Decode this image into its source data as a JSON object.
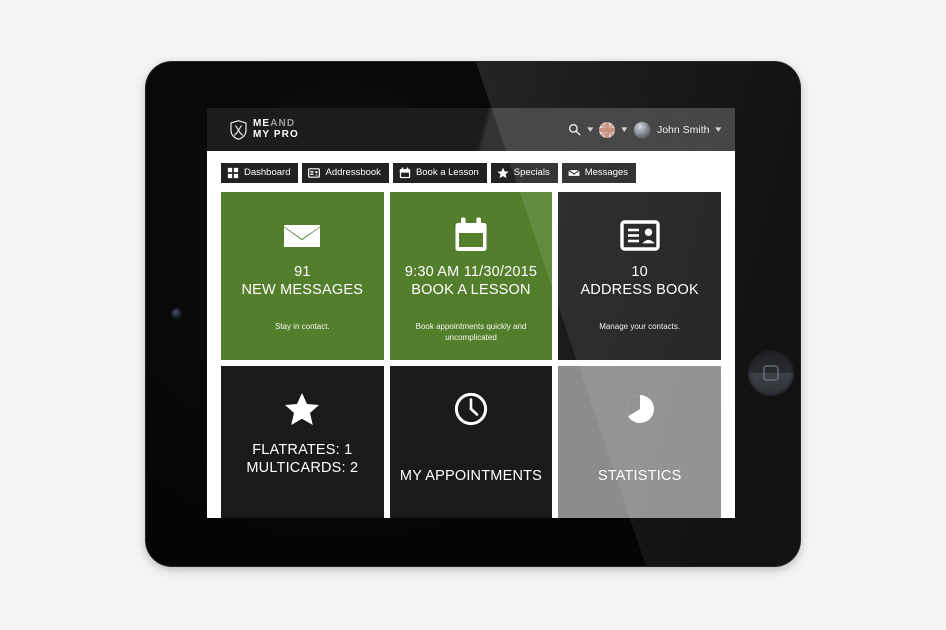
{
  "app": {
    "brand": {
      "line1_strong": "ME",
      "line1_soft": "AND",
      "line2": "MY PRO",
      "shield_icon": "shield-crossed-clubs-icon"
    },
    "header": {
      "search_icon": "search-icon",
      "search_chevron": "chevron-down-icon",
      "language_flag": "uk-flag-icon",
      "language_chevron": "chevron-down-icon",
      "avatar_icon": "user-avatar",
      "user_name": "John Smith",
      "user_chevron": "chevron-down-icon"
    },
    "nav": [
      {
        "label": "Dashboard",
        "icon": "grid-icon"
      },
      {
        "label": "Addressbook",
        "icon": "contact-card-icon"
      },
      {
        "label": "Book a Lesson",
        "icon": "calendar-icon"
      },
      {
        "label": "Specials",
        "icon": "star-icon"
      },
      {
        "label": "Messages",
        "icon": "envelope-icon"
      }
    ],
    "tiles": [
      {
        "id": "new-messages",
        "icon": "envelope-icon",
        "value": "91",
        "label": "NEW MESSAGES",
        "subtitle": "Stay in contact.",
        "color": "#537f2d",
        "theme": "green"
      },
      {
        "id": "book-a-lesson",
        "icon": "calendar-icon",
        "value": "9:30 AM 11/30/2015",
        "label": "BOOK A LESSON",
        "subtitle": "Book appointments quickly and uncomplicated",
        "color": "#537f2d",
        "theme": "green"
      },
      {
        "id": "address-book",
        "icon": "contact-card-icon",
        "value": "10",
        "label": "ADDRESS BOOK",
        "subtitle": "Manage your contacts.",
        "color": "#1a1a1a",
        "theme": "dark"
      },
      {
        "id": "specials",
        "icon": "star-icon",
        "value": "FLATRATES: 1",
        "label": "MULTICARDS: 2",
        "subtitle": "",
        "color": "#1a1a1a",
        "theme": "dark"
      },
      {
        "id": "my-appointments",
        "icon": "clock-icon",
        "value": "",
        "label": "MY APPOINTMENTS",
        "subtitle": "",
        "color": "#1a1a1a",
        "theme": "dark"
      },
      {
        "id": "statistics",
        "icon": "pie-chart-icon",
        "value": "",
        "label": "STATISTICS",
        "subtitle": "",
        "color": "#8c8c8c",
        "theme": "gray"
      }
    ]
  },
  "device": {
    "type": "tablet",
    "bezel_color": "#050505",
    "home_button_icon": "home-button-icon",
    "camera_icon": "front-camera-icon"
  },
  "page_background": "#f4f4f4"
}
